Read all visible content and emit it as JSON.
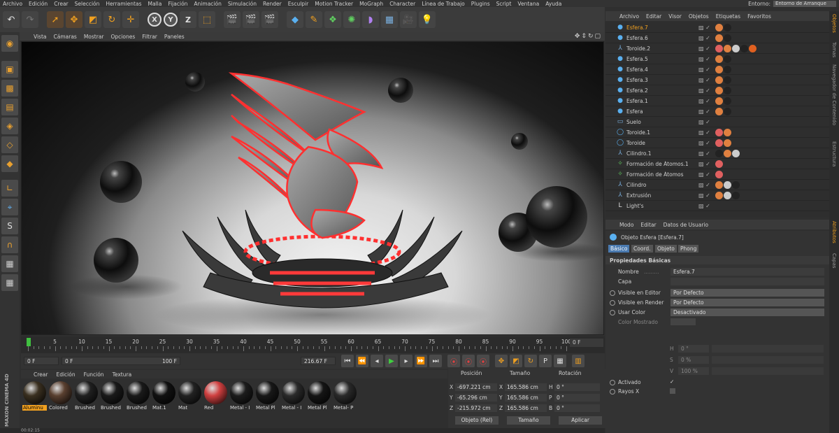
{
  "menubar": {
    "items": [
      "Archivo",
      "Edición",
      "Crear",
      "Selección",
      "Herramientas",
      "Malla",
      "Fijación",
      "Animación",
      "Simulación",
      "Render",
      "Esculpir",
      "Motion Tracker",
      "MoGraph",
      "Character",
      "Línea de Trabajo",
      "Plugins",
      "Script",
      "Ventana",
      "Ayuda"
    ],
    "env_label": "Entorno:",
    "env_value": "Entorno de Arranque"
  },
  "viewport": {
    "menu": [
      "Vista",
      "Cámaras",
      "Mostrar",
      "Opciones",
      "Filtrar",
      "Paneles"
    ]
  },
  "timeline": {
    "ticks": [
      "0",
      "5",
      "10",
      "15",
      "20",
      "25",
      "30",
      "35",
      "40",
      "45",
      "50",
      "55",
      "60",
      "65",
      "70",
      "75",
      "80",
      "85",
      "90",
      "95",
      "100"
    ],
    "current_frame": "0 F",
    "start": "0 F",
    "range_start": "0 F",
    "range_end": "100 F",
    "end": "216.67 F"
  },
  "materials": {
    "menu": [
      "Crear",
      "Edición",
      "Función",
      "Textura"
    ],
    "items": [
      {
        "label": "Aluminu",
        "color": "#3a3020",
        "selected": true
      },
      {
        "label": "Colored",
        "color": "#5a4030",
        "selected": false
      },
      {
        "label": "Brushed",
        "color": "#202020",
        "selected": false
      },
      {
        "label": "Brushed",
        "color": "#1a1a1a",
        "selected": false
      },
      {
        "label": "Brushed",
        "color": "#1a1a1a",
        "selected": false
      },
      {
        "label": "Mat.1",
        "color": "#111111",
        "selected": false
      },
      {
        "label": "Mat",
        "color": "#222222",
        "selected": false
      },
      {
        "label": "Red",
        "color": "#d04040",
        "selected": false
      },
      {
        "label": "Metal - I",
        "color": "#1c1c1c",
        "selected": false
      },
      {
        "label": "Metal Pl",
        "color": "#181818",
        "selected": false
      },
      {
        "label": "Metal - I",
        "color": "#2a2a2a",
        "selected": false
      },
      {
        "label": "Metal Pl",
        "color": "#151515",
        "selected": false
      },
      {
        "label": "Metal- P",
        "color": "#2a2a2a",
        "selected": false
      }
    ],
    "logo_line1": "MAXON",
    "logo_line2": "CINEMA 4D"
  },
  "statusbar": {
    "time": "00:02:15"
  },
  "coords": {
    "headers": {
      "position": "Posición",
      "size": "Tamaño",
      "rotation": "Rotación"
    },
    "rows": [
      {
        "axis": "X",
        "pos": "-697.221 cm",
        "size_axis": "X",
        "size": "165.586 cm",
        "rot_axis": "H",
        "rot": "0 °"
      },
      {
        "axis": "Y",
        "pos": "-65.296 cm",
        "size_axis": "Y",
        "size": "165.586 cm",
        "rot_axis": "P",
        "rot": "0 °"
      },
      {
        "axis": "Z",
        "pos": "-215.972 cm",
        "size_axis": "Z",
        "size": "165.586 cm",
        "rot_axis": "B",
        "rot": "0 °"
      }
    ],
    "mode": "Objeto (Rel)",
    "size_mode": "Tamaño",
    "apply": "Aplicar"
  },
  "objmanager": {
    "menu": [
      "Archivo",
      "Editar",
      "Visor",
      "Objetos",
      "Etiquetas",
      "Favoritos"
    ],
    "objects": [
      {
        "name": "Esfera.7",
        "icon": "sphere-icon",
        "selected": true,
        "tags": [
          "#e08040",
          "#222"
        ]
      },
      {
        "name": "Esfera.6",
        "icon": "sphere-icon",
        "selected": false,
        "tags": [
          "#e08040",
          "#222"
        ]
      },
      {
        "name": "Toroide.2",
        "icon": "bend-icon",
        "selected": false,
        "tags": [
          "#e06060",
          "#e08040",
          "#ccc",
          "#222",
          "#e06020"
        ]
      },
      {
        "name": "Esfera.5",
        "icon": "sphere-icon",
        "selected": false,
        "tags": [
          "#e08040",
          "#222"
        ]
      },
      {
        "name": "Esfera.4",
        "icon": "sphere-icon",
        "selected": false,
        "tags": [
          "#e08040",
          "#222"
        ]
      },
      {
        "name": "Esfera.3",
        "icon": "sphere-icon",
        "selected": false,
        "tags": [
          "#e08040",
          "#222"
        ]
      },
      {
        "name": "Esfera.2",
        "icon": "sphere-icon",
        "selected": false,
        "tags": [
          "#e08040",
          "#222"
        ]
      },
      {
        "name": "Esfera.1",
        "icon": "sphere-icon",
        "selected": false,
        "tags": [
          "#e08040",
          "#222"
        ]
      },
      {
        "name": "Esfera",
        "icon": "sphere-icon",
        "selected": false,
        "tags": [
          "#e08040",
          "#222"
        ]
      },
      {
        "name": "Suelo",
        "icon": "floor-icon",
        "selected": false,
        "tags": []
      },
      {
        "name": "Toroide.1",
        "icon": "torus-icon",
        "selected": false,
        "tags": [
          "#e06060",
          "#e08040"
        ]
      },
      {
        "name": "Toroide",
        "icon": "torus-icon",
        "selected": false,
        "tags": [
          "#e06060",
          "#e08040"
        ]
      },
      {
        "name": "Cilindro.1",
        "icon": "bend-icon",
        "selected": false,
        "tags": [
          "#222",
          "#e08040",
          "#ccc"
        ]
      },
      {
        "name": "Formación de Átomos.1",
        "icon": "atom-icon",
        "selected": false,
        "tags": [
          "#e06060"
        ]
      },
      {
        "name": "Formación de Átomos",
        "icon": "atom-icon",
        "selected": false,
        "tags": [
          "#e06060"
        ]
      },
      {
        "name": "Cilindro",
        "icon": "bend-icon",
        "selected": false,
        "tags": [
          "#e08040",
          "#ccc",
          "#222"
        ]
      },
      {
        "name": "Extrusión",
        "icon": "bend-icon",
        "selected": false,
        "tags": [
          "#e08040",
          "#ccc",
          "#222"
        ]
      },
      {
        "name": "Light's",
        "icon": "null-icon",
        "selected": false,
        "tags": []
      }
    ]
  },
  "attrmanager": {
    "menu": [
      "Modo",
      "Editar",
      "Datos de Usuario"
    ],
    "object_title": "Objeto Esfera [Esfera.7]",
    "tabs": [
      "Básico",
      "Coord.",
      "Objeto",
      "Phong"
    ],
    "section": "Propiedades Básicas",
    "name_label": "Nombre",
    "name_value": "Esfera.7",
    "layer_label": "Capa",
    "editor_label": "Visible en Editor",
    "editor_value": "Por Defecto",
    "render_label": "Visible en Render",
    "render_value": "Por Defecto",
    "color_label": "Usar Color",
    "color_value": "Desactivado",
    "shown_color_label": "Color Mostrado",
    "h_label": "H",
    "h_value": "0 °",
    "s_label": "S",
    "s_value": "0 %",
    "v_label": "V",
    "v_value": "100 %",
    "active_label": "Activado",
    "xray_label": "Rayos X"
  },
  "sidestrip": [
    "Objetos",
    "Tomas",
    "Navegador de Contenido",
    "Estructura",
    "Atributos",
    "Capas"
  ]
}
